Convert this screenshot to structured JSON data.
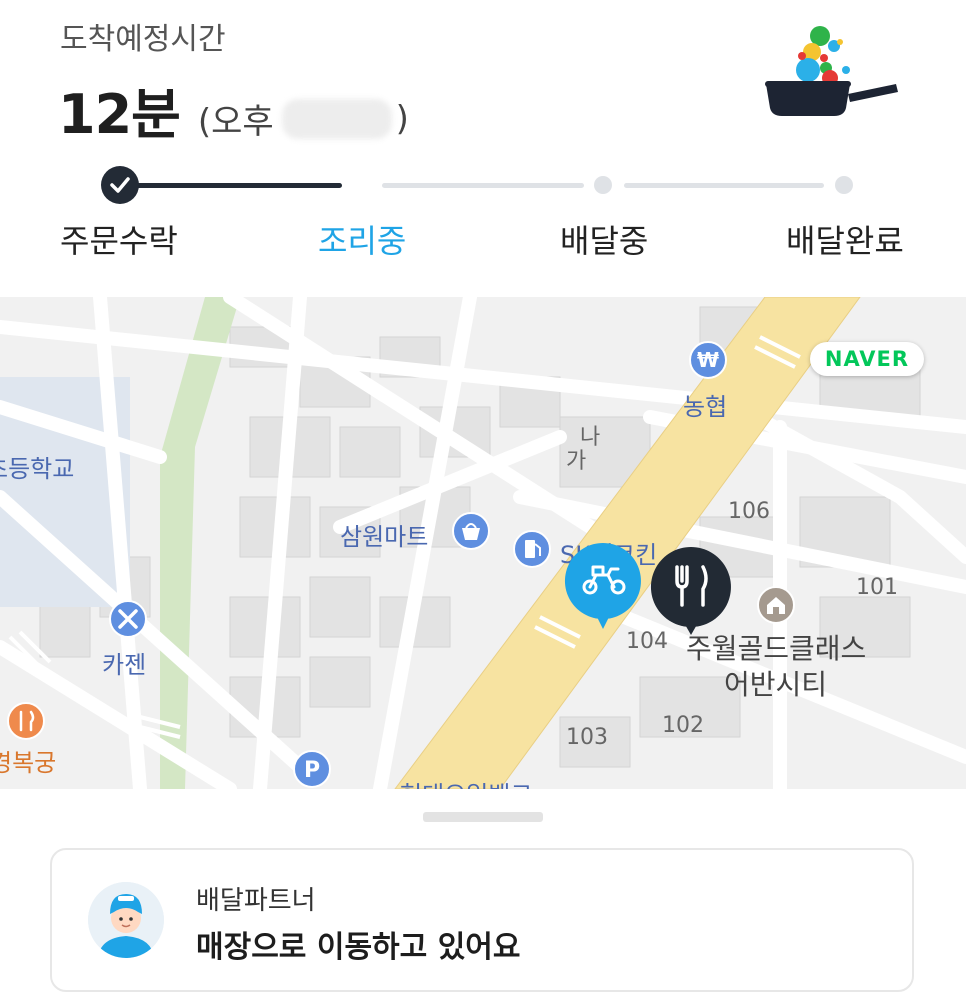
{
  "header": {
    "eta_label": "도착예정시간",
    "eta_minutes": "12분",
    "eta_clock_prefix": "(오후",
    "eta_clock_suffix": ")"
  },
  "progress": {
    "current_step_index": 1,
    "steps": [
      {
        "label": "주문수락",
        "state": "done"
      },
      {
        "label": "조리중",
        "state": "active"
      },
      {
        "label": "배달중",
        "state": "pending"
      },
      {
        "label": "배달완료",
        "state": "pending"
      }
    ]
  },
  "map": {
    "naver_badge": "NAVER",
    "labels": {
      "school": "초등학교",
      "nonghyup": "농협",
      "na": "나",
      "ga": "가",
      "samwon": "삼원마트",
      "gas": "SK에코킨",
      "kajen": "카젠",
      "restaurant": "경복궁",
      "building": "주월골드클래스",
      "building2": "어반시티",
      "n106": "106",
      "n104": "104",
      "n103": "103",
      "n102": "102",
      "n101": "101",
      "bottom": "현대오일뱅크"
    },
    "icons": {
      "rider": "scooter-icon",
      "store": "fork-knife-icon"
    }
  },
  "rider_card": {
    "title": "배달파트너",
    "status": "매장으로 이동하고 있어요"
  },
  "colors": {
    "accent": "#1fa4e6",
    "done": "#232b36",
    "pending": "#d8dbe0",
    "road_main": "#f7e3a1",
    "naver_green": "#03c75a"
  }
}
